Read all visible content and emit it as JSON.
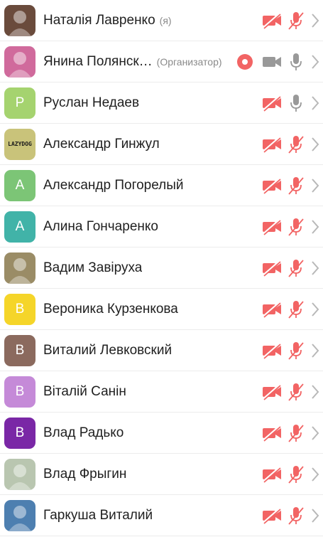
{
  "participants": [
    {
      "name": "Наталія Лавренко",
      "tag": "(я)",
      "avatar_letter": "",
      "avatar_color": "#6a4b3c",
      "avatar_type": "photo",
      "cam_off": true,
      "mic_muted": true,
      "recording": false
    },
    {
      "name": "Янина Полянск…",
      "tag": "(Организатор)",
      "avatar_letter": "",
      "avatar_color": "#d06a9c",
      "avatar_type": "photo",
      "cam_off": false,
      "mic_muted": false,
      "recording": true
    },
    {
      "name": "Руслан Недаев",
      "tag": "",
      "avatar_letter": "Р",
      "avatar_color": "#a5d36f",
      "avatar_type": "letter",
      "cam_off": true,
      "mic_muted": false,
      "recording": false
    },
    {
      "name": "Александр Гинжул",
      "tag": "",
      "avatar_letter": "",
      "avatar_color": "#c9c37a",
      "avatar_type": "photo",
      "logo_text": "LAZYDOG",
      "cam_off": true,
      "mic_muted": true,
      "recording": false
    },
    {
      "name": "Александр Погорелый",
      "tag": "",
      "avatar_letter": "А",
      "avatar_color": "#7cc576",
      "avatar_type": "letter",
      "cam_off": true,
      "mic_muted": true,
      "recording": false
    },
    {
      "name": "Алина Гончаренко",
      "tag": "",
      "avatar_letter": "А",
      "avatar_color": "#41b3a8",
      "avatar_type": "letter",
      "cam_off": true,
      "mic_muted": true,
      "recording": false
    },
    {
      "name": "Вадим Завіруха",
      "tag": "",
      "avatar_letter": "",
      "avatar_color": "#9a8c66",
      "avatar_type": "photo",
      "cam_off": true,
      "mic_muted": true,
      "recording": false
    },
    {
      "name": "Вероника Курзенкова",
      "tag": "",
      "avatar_letter": "В",
      "avatar_color": "#f5d529",
      "avatar_type": "letter",
      "cam_off": true,
      "mic_muted": true,
      "recording": false
    },
    {
      "name": "Виталий Левковский",
      "tag": "",
      "avatar_letter": "В",
      "avatar_color": "#8b6a5e",
      "avatar_type": "letter",
      "cam_off": true,
      "mic_muted": true,
      "recording": false
    },
    {
      "name": "Віталій Санін",
      "tag": "",
      "avatar_letter": "В",
      "avatar_color": "#c58ad8",
      "avatar_type": "letter",
      "cam_off": true,
      "mic_muted": true,
      "recording": false
    },
    {
      "name": "Влад Радько",
      "tag": "",
      "avatar_letter": "В",
      "avatar_color": "#7a27a6",
      "avatar_type": "letter",
      "cam_off": true,
      "mic_muted": true,
      "recording": false
    },
    {
      "name": "Влад Фрыгин",
      "tag": "",
      "avatar_letter": "",
      "avatar_color": "#b9c6b0",
      "avatar_type": "photo",
      "cam_off": true,
      "mic_muted": true,
      "recording": false
    },
    {
      "name": "Гаркуша Виталий",
      "tag": "",
      "avatar_letter": "",
      "avatar_color": "#4d7fb0",
      "avatar_type": "photo",
      "cam_off": true,
      "mic_muted": true,
      "recording": false
    }
  ],
  "colors": {
    "muted_red": "#f26464",
    "icon_gray": "#999999",
    "chevron_gray": "#b8b8b8",
    "record_red": "#f26464"
  },
  "icons": {
    "camera": "video-camera-icon",
    "mic": "microphone-icon",
    "chevron": "chevron-right-icon",
    "record": "record-icon"
  }
}
